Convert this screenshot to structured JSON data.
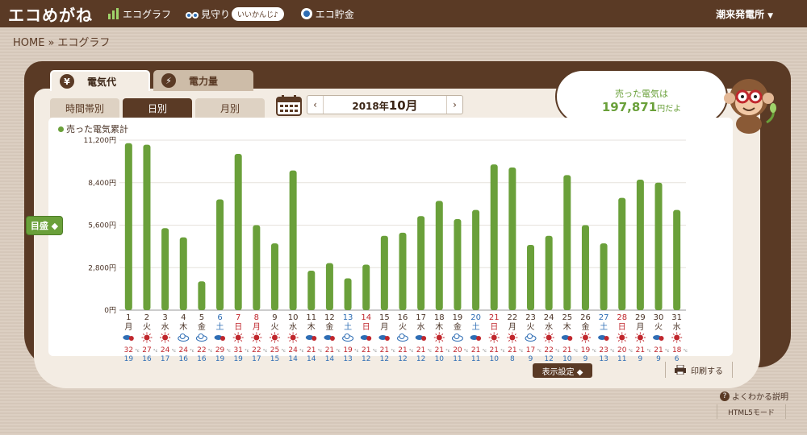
{
  "header": {
    "logo": "エコめがね",
    "nav": [
      {
        "label": "エコグラフ",
        "icon": "bar-graph-icon"
      },
      {
        "label": "見守り",
        "icon": "binoculars-icon"
      },
      {
        "label": "エコ貯金",
        "icon": "piggy-bank-icon"
      }
    ],
    "bubble": "いいかんじ♪",
    "account": "潮来発電所"
  },
  "breadcrumb": {
    "home": "HOME",
    "sep": "»",
    "current": "エコグラフ"
  },
  "tabs": {
    "yen_label": "電気代",
    "yen_icon": "¥",
    "power_label": "電力量",
    "power_icon": "⚡"
  },
  "subtabs": [
    "時間帯別",
    "日別",
    "月別"
  ],
  "month_nav": {
    "year": "2018年",
    "month": "10月",
    "prev": "‹",
    "next": "›"
  },
  "speech": {
    "line1": "売った電気は",
    "amount": "197,871",
    "suffix": "円だよ"
  },
  "side_button": "目盛 ◆",
  "buttons": {
    "display_settings": "表示設定 ◆",
    "print": "印刷する",
    "help": "よくわかる説明",
    "html5": "HTML5モード"
  },
  "colors": {
    "bar": "#6aa03a",
    "brown": "#5a3a25",
    "weekday": "#4a3326",
    "saturday": "#2e6db4",
    "sunday": "#c0272d",
    "high": "#c0272d",
    "low": "#2e6db4"
  },
  "chart_data": {
    "type": "bar",
    "title": "",
    "legend": "売った電気累計",
    "y_ticks": [
      "0円",
      "2,800円",
      "5,600円",
      "8,400円",
      "11,200円"
    ],
    "ylim": [
      0,
      11200
    ],
    "grid": true,
    "categories": [
      "1",
      "2",
      "3",
      "4",
      "5",
      "6",
      "7",
      "8",
      "9",
      "10",
      "11",
      "12",
      "13",
      "14",
      "15",
      "16",
      "17",
      "18",
      "19",
      "20",
      "21",
      "22",
      "23",
      "24",
      "25",
      "26",
      "27",
      "28",
      "29",
      "30",
      "31"
    ],
    "weekdays": [
      "月",
      "火",
      "水",
      "木",
      "金",
      "土",
      "日",
      "月",
      "火",
      "水",
      "木",
      "金",
      "土",
      "日",
      "月",
      "火",
      "水",
      "木",
      "金",
      "土",
      "日",
      "月",
      "火",
      "水",
      "木",
      "金",
      "土",
      "日",
      "月",
      "火",
      "水"
    ],
    "day_types": [
      "wd",
      "wd",
      "wd",
      "wd",
      "wd",
      "sat",
      "sun",
      "hol",
      "wd",
      "wd",
      "wd",
      "wd",
      "sat",
      "sun",
      "wd",
      "wd",
      "wd",
      "wd",
      "wd",
      "sat",
      "sun",
      "wd",
      "wd",
      "wd",
      "wd",
      "wd",
      "sat",
      "sun",
      "wd",
      "wd",
      "wd"
    ],
    "values": [
      11000,
      10900,
      5400,
      4800,
      1900,
      7300,
      10300,
      5600,
      4400,
      9200,
      2600,
      3100,
      2100,
      3000,
      4900,
      5100,
      6200,
      7200,
      6000,
      6600,
      9600,
      9400,
      4300,
      4900,
      8900,
      5600,
      4400,
      7400,
      8600,
      8400,
      6600
    ],
    "weather_icons": [
      "cloud-sun",
      "sun",
      "sun",
      "cloud",
      "cloud",
      "cloud-sun",
      "sun",
      "sun",
      "sun",
      "sun",
      "cloud-sun",
      "cloud-sun",
      "cloud",
      "cloud-sun",
      "cloud-sun",
      "cloud",
      "cloud-sun",
      "sun",
      "cloud",
      "cloud-sun",
      "sun",
      "sun",
      "cloud",
      "sun",
      "cloud-sun",
      "sun",
      "cloud-sun",
      "sun",
      "sun",
      "cloud-sun",
      "sun"
    ],
    "temp_high": [
      "32",
      "27",
      "24",
      "24",
      "22",
      "29",
      "31",
      "22",
      "25",
      "24",
      "21",
      "21",
      "19",
      "21",
      "21",
      "21",
      "21",
      "21",
      "20",
      "21",
      "21",
      "21",
      "17",
      "22",
      "21",
      "19",
      "23",
      "20",
      "21",
      "21",
      "18"
    ],
    "temp_low": [
      "19",
      "16",
      "17",
      "16",
      "16",
      "19",
      "19",
      "17",
      "15",
      "14",
      "14",
      "14",
      "13",
      "12",
      "12",
      "12",
      "12",
      "10",
      "11",
      "11",
      "10",
      "8",
      "9",
      "12",
      "10",
      "9",
      "13",
      "11",
      "9",
      "9",
      "6"
    ],
    "temp_unit": "°c"
  }
}
